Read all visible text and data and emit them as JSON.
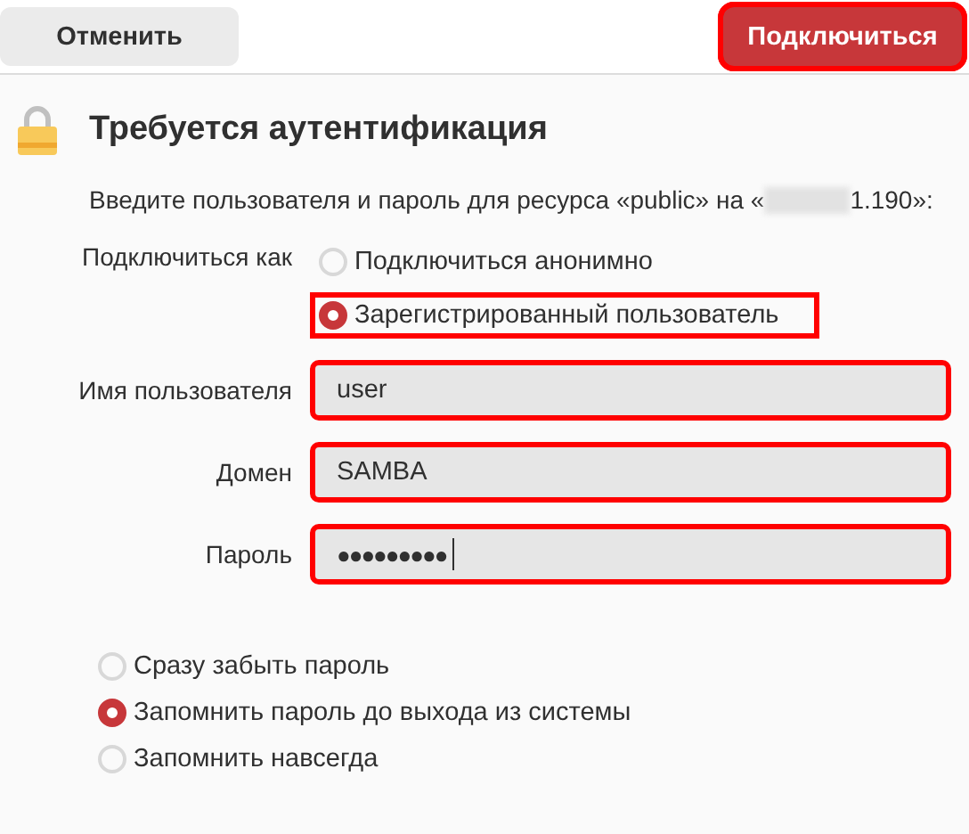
{
  "header": {
    "buttons": [
      {
        "label": "Отменить",
        "kind": "cancel",
        "highlighted": false
      },
      {
        "label": "Подключиться",
        "kind": "suggested",
        "highlighted": true
      }
    ]
  },
  "title": "Требуется аутентификация",
  "prompt": {
    "before": "Введите пользователя и пароль для ресурса «public» на «",
    "after": "1.190»:",
    "redacted": true
  },
  "connect_as": {
    "label": "Подключиться как",
    "options": [
      {
        "label": "Подключиться анонимно",
        "selected": false,
        "highlighted": false
      },
      {
        "label": "Зарегистрированный пользователь",
        "selected": true,
        "highlighted": true
      }
    ]
  },
  "fields": [
    {
      "label": "Имя пользователя",
      "value": "user",
      "kind": "text",
      "highlighted": true
    },
    {
      "label": "Домен",
      "value": "SAMBA",
      "kind": "text",
      "highlighted": true
    },
    {
      "label": "Пароль",
      "value": "●●●●●●●●●",
      "kind": "password",
      "highlighted": true
    }
  ],
  "remember": [
    {
      "label": "Сразу забыть пароль",
      "selected": false
    },
    {
      "label": "Запомнить пароль до выхода из системы",
      "selected": true
    },
    {
      "label": "Запомнить навсегда",
      "selected": false
    }
  ]
}
